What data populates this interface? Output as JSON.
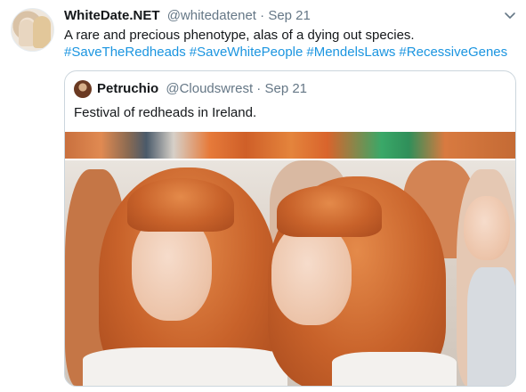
{
  "tweet": {
    "name": "WhiteDate.NET",
    "handle": "@whitedatenet",
    "separator": "·",
    "date": "Sep 21",
    "text": "A rare and precious phenotype, alas of a dying out species.",
    "hashtags": [
      "#SaveTheRedheads",
      "#SaveWhitePeople",
      "#MendelsLaws",
      "#RecessiveGenes"
    ],
    "menu_icon": "chevron-down-icon"
  },
  "quoted": {
    "name": "Petruchio",
    "handle": "@Cloudswrest",
    "separator": "·",
    "date": "Sep 21",
    "text": "Festival of redheads in Ireland."
  },
  "colors": {
    "text": "#14171a",
    "muted": "#657786",
    "link": "#1b95e0",
    "border": "#ccd6dd"
  }
}
